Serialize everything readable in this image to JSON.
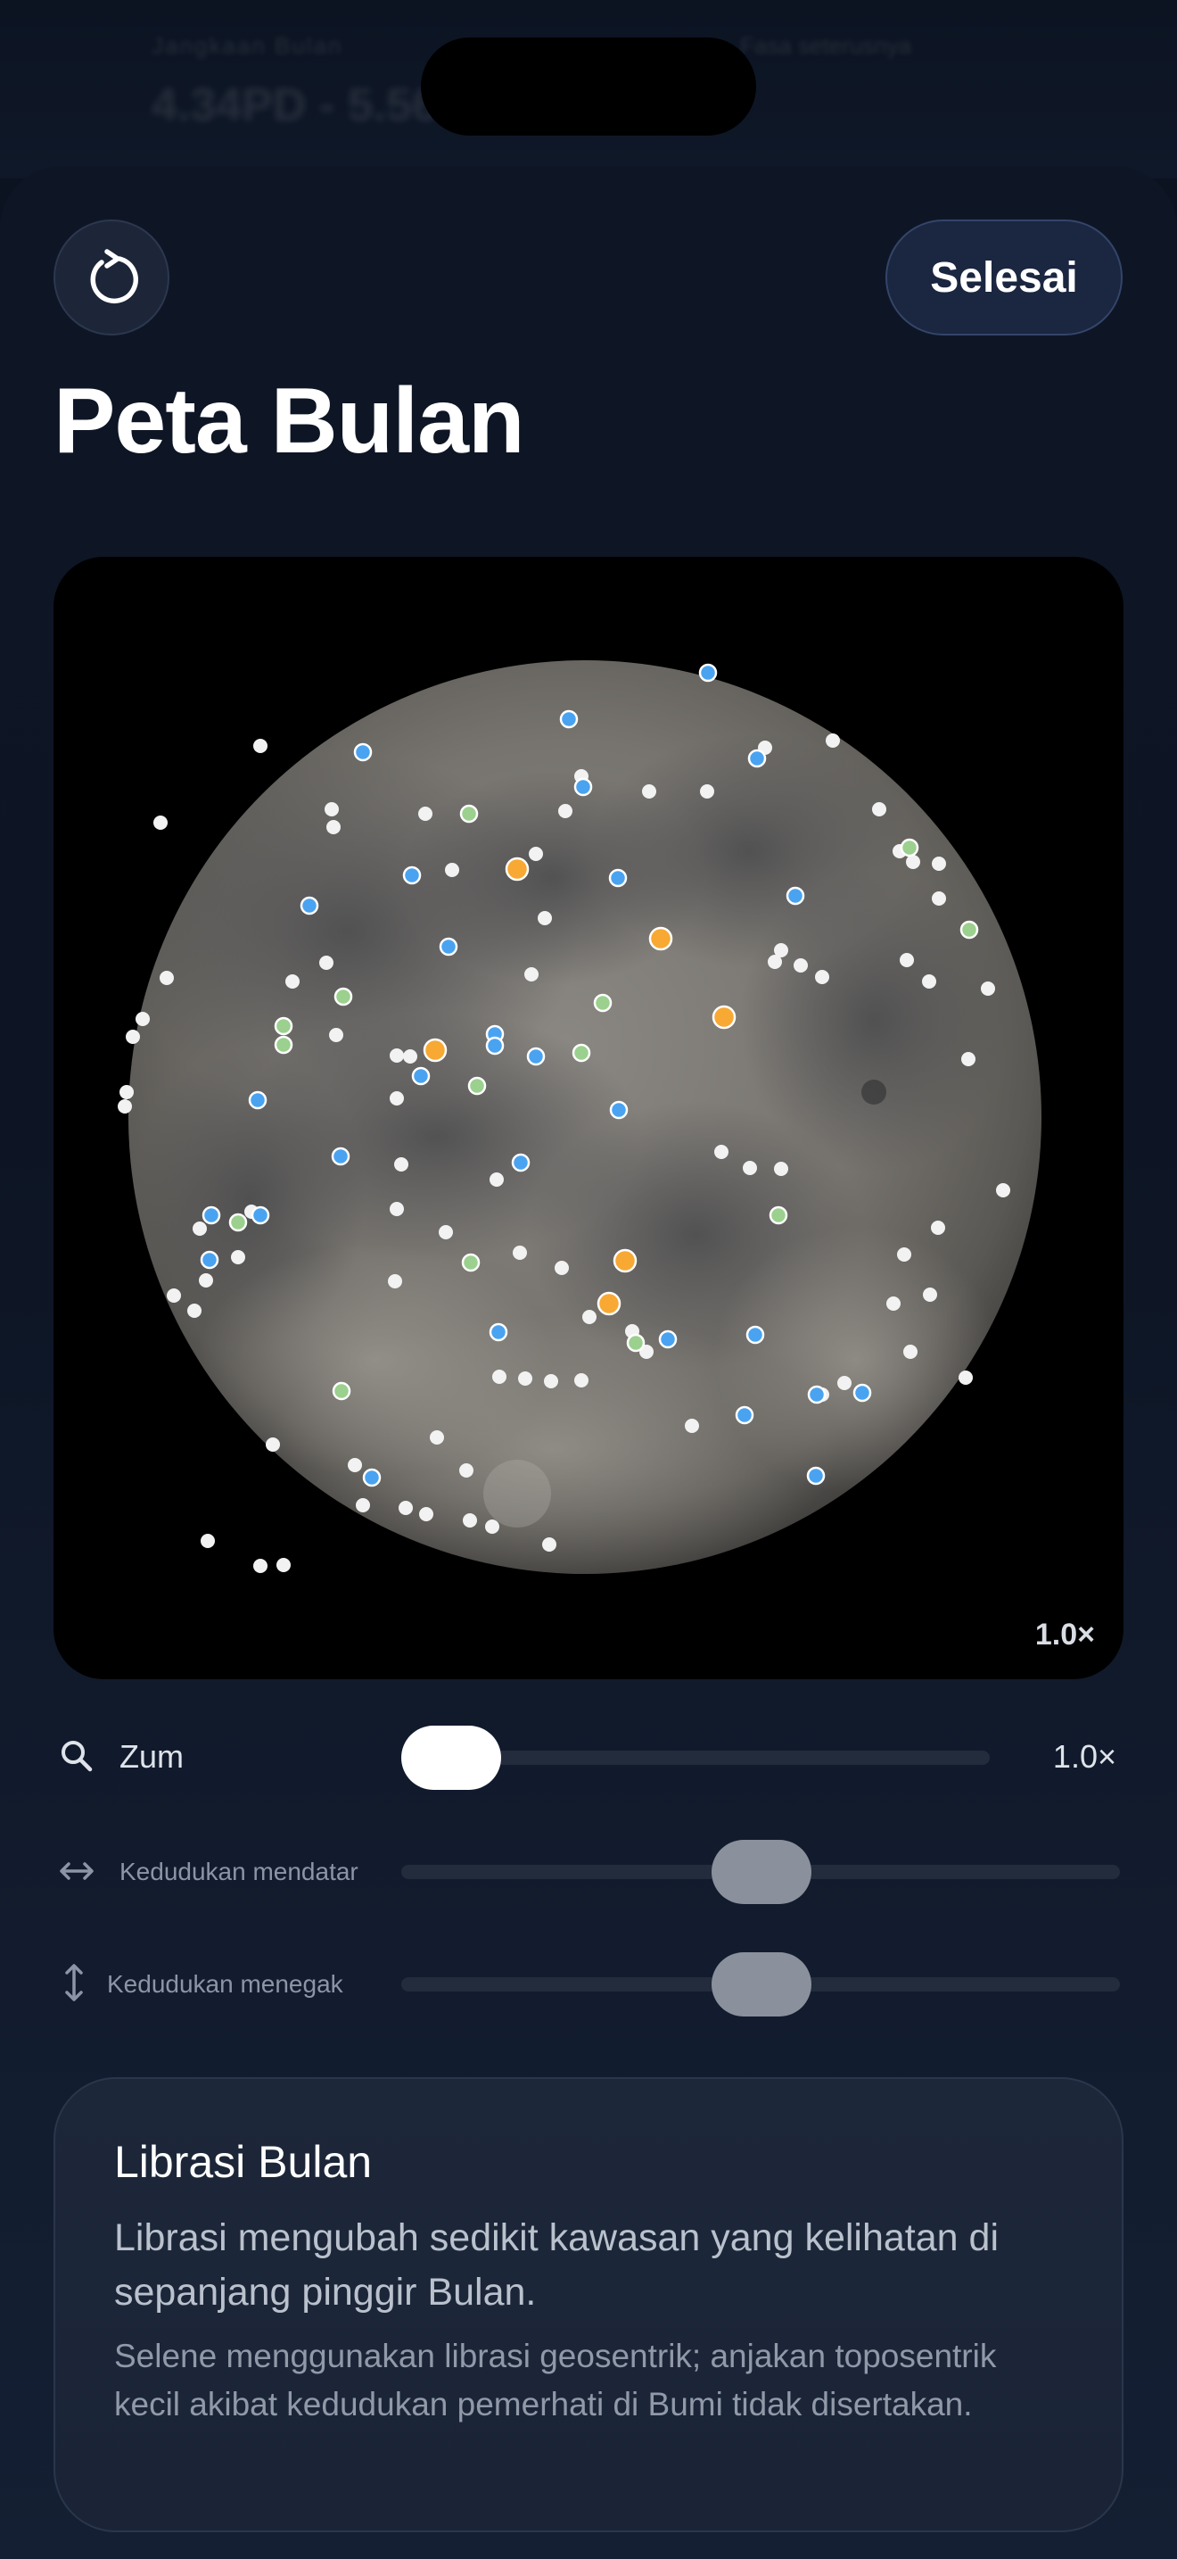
{
  "background": {
    "label": "Jangkaan Bulan",
    "value": "4.34PD - 5.56PD",
    "right_label": "Fasa seterusnya"
  },
  "header": {
    "reset_icon": "reset-icon",
    "done_label": "Selesai",
    "title": "Peta Bulan"
  },
  "map": {
    "zoom_badge": "1.0×",
    "marker_colors": {
      "white": "#f2f2f2",
      "blue": "#4aa3f0",
      "green": "#9bd08e",
      "orange": "#f7a933"
    }
  },
  "controls": {
    "zoom": {
      "icon": "search-icon",
      "label": "Zum",
      "value": "1.0×",
      "level": 0.0
    },
    "horizontal": {
      "icon": "arrows-horizontal-icon",
      "label": "Kedudukan mendatar",
      "level": 0.5
    },
    "vertical": {
      "icon": "arrows-vertical-icon",
      "label": "Kedudukan menegak",
      "level": 0.5
    }
  },
  "info": {
    "title": "Librasi Bulan",
    "body": "Librasi mengubah sedikit kawasan yang kelihatan di sepanjang pinggir Bulan.",
    "note": "Selene menggunakan librasi geosentrik; anjakan toposentrik kecil akibat kedudukan pemerhati di Bumi tidak disertakan."
  }
}
